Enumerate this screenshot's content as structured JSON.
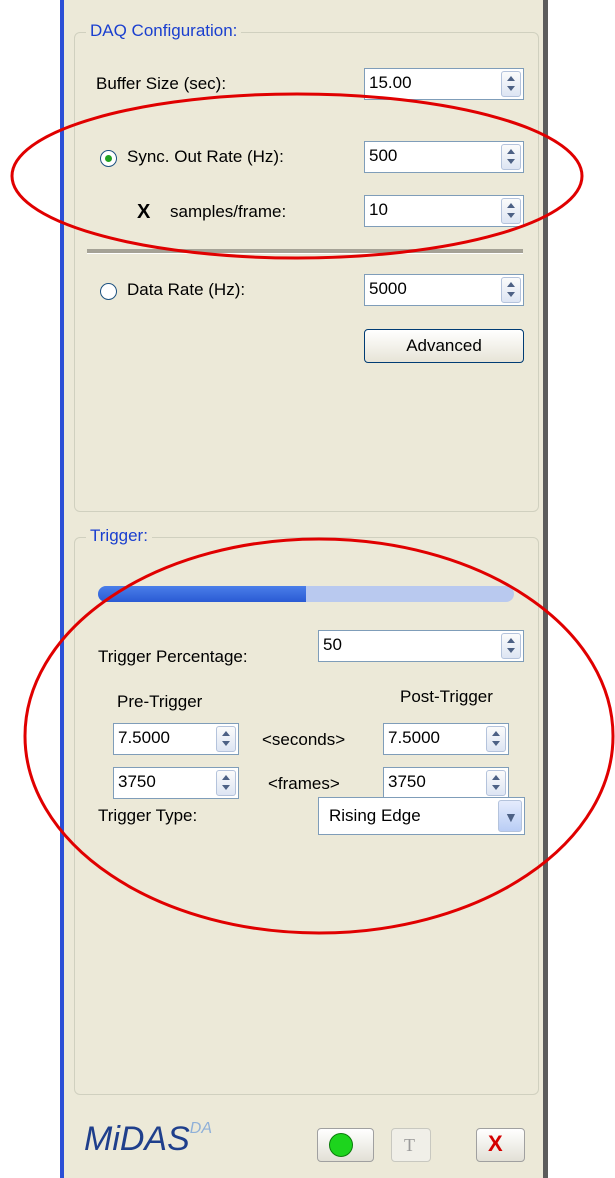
{
  "daq": {
    "title": "DAQ Configuration:",
    "buffer_label": "Buffer Size (sec):",
    "buffer_value": "15.00",
    "sync_label": "Sync. Out Rate (Hz):",
    "sync_value": "500",
    "multiply_symbol": "X",
    "samples_label": "samples/frame:",
    "samples_value": "10",
    "data_rate_label": "Data Rate (Hz):",
    "data_rate_value": "5000",
    "advanced_label": "Advanced",
    "selected_mode": "sync"
  },
  "trigger": {
    "title": "Trigger:",
    "percentage_label": "Trigger Percentage:",
    "percentage_value": "50",
    "percentage_fraction": 0.5,
    "pre_label": "Pre-Trigger",
    "post_label": "Post-Trigger",
    "seconds_label": "<seconds>",
    "frames_label": "<frames>",
    "pre_seconds": "7.5000",
    "post_seconds": "7.5000",
    "pre_frames": "3750",
    "post_frames": "3750",
    "type_label": "Trigger Type:",
    "type_value": "Rising Edge"
  },
  "footer": {
    "logo_main": "MiDAS",
    "logo_sup": "DA",
    "t_glyph": "T",
    "x_glyph": "X"
  },
  "colors": {
    "panel": "#ece9d8",
    "group_title": "#1a3fcf",
    "annotation": "#e00000",
    "run_indicator": "#1dd41d"
  },
  "icons": [
    "spin-arrows-icon",
    "radio-icon",
    "dropdown-arrow-icon",
    "green-dot-icon",
    "t-icon",
    "close-x-icon"
  ]
}
